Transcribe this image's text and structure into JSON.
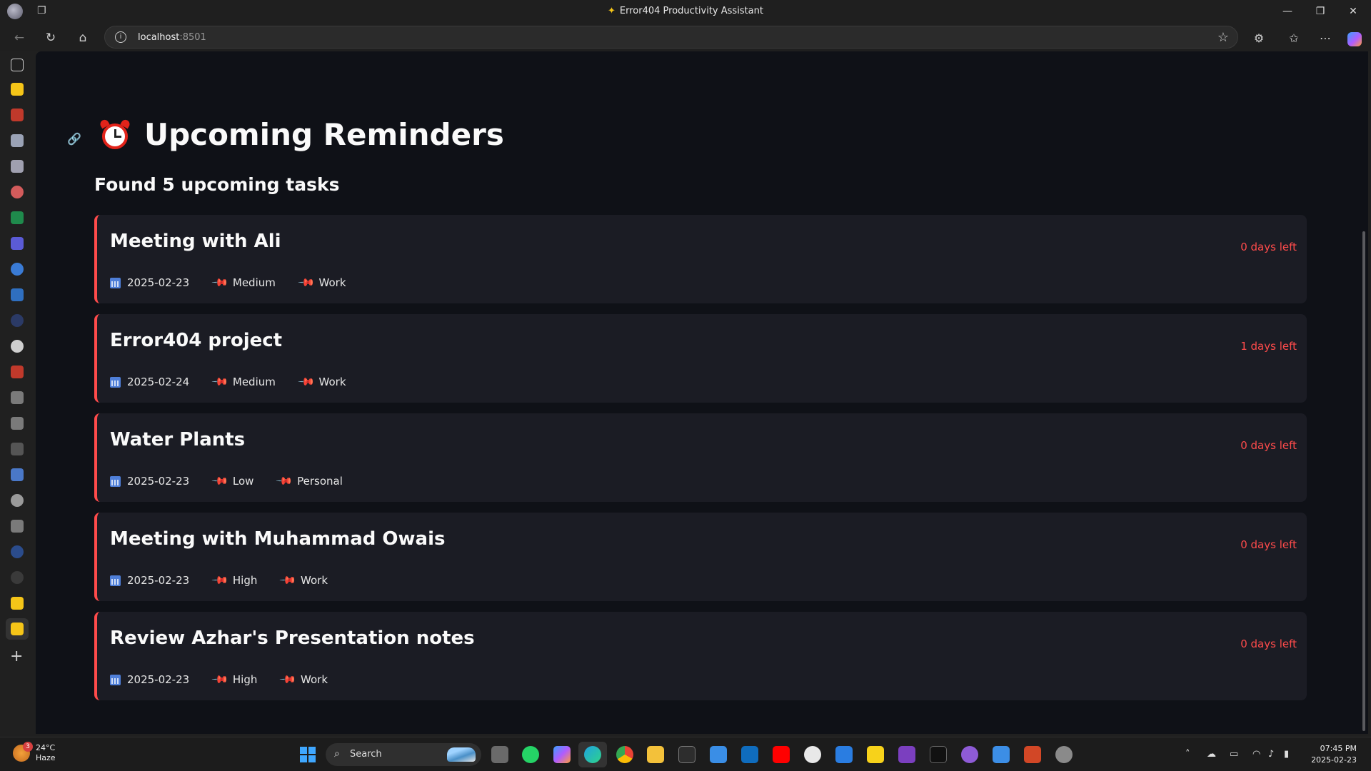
{
  "window": {
    "title": "Error404 Productivity Assistant"
  },
  "browser": {
    "url_host": "localhost",
    "url_port": ":8501"
  },
  "page": {
    "title": "Upcoming Reminders",
    "subtitle": "Found 5 upcoming tasks"
  },
  "reminders": [
    {
      "title": "Meeting with Ali",
      "days_left": "0 days left",
      "date": "2025-02-23",
      "priority": "Medium",
      "category": "Work"
    },
    {
      "title": "Error404 project",
      "days_left": "1 days left",
      "date": "2025-02-24",
      "priority": "Medium",
      "category": "Work"
    },
    {
      "title": "Water Plants",
      "days_left": "0 days left",
      "date": "2025-02-23",
      "priority": "Low",
      "category": "Personal"
    },
    {
      "title": "Meeting with Muhammad Owais",
      "days_left": "0 days left",
      "date": "2025-02-23",
      "priority": "High",
      "category": "Work"
    },
    {
      "title": "Review Azhar's Presentation notes",
      "days_left": "0 days left",
      "date": "2025-02-23",
      "priority": "High",
      "category": "Work"
    }
  ],
  "taskbar": {
    "weather_temp": "24°C",
    "weather_desc": "Haze",
    "weather_badge": "3",
    "search_label": "Search",
    "time": "07:45 PM",
    "date": "2025-02-23"
  },
  "colors": {
    "accent_red": "#ff4b4b",
    "background": "#0f1117",
    "card": "#1b1c24"
  },
  "icons": {
    "page_title": "alarm-clock-icon",
    "date": "calendar-icon",
    "priority": "pushpin-icon",
    "category": "pushpin-icon"
  }
}
